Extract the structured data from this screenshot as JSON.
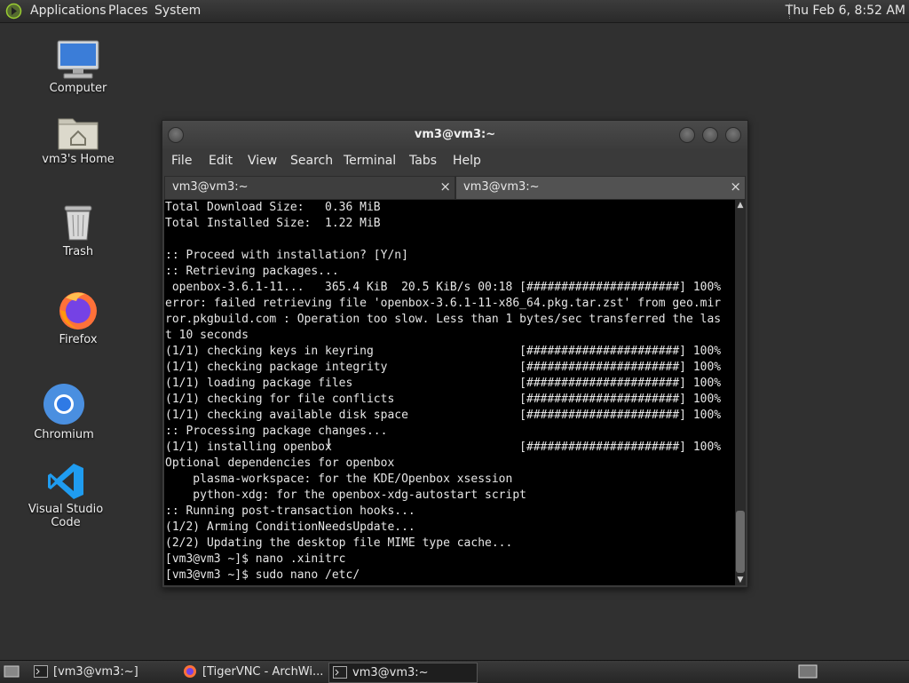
{
  "top_panel": {
    "menus": [
      "Applications",
      "Places",
      "System"
    ],
    "clock": "Thu Feb  6,  8:52 AM"
  },
  "desktop_icons": [
    {
      "label": "Computer",
      "icon": "computer-icon"
    },
    {
      "label": "vm3's Home",
      "icon": "home-folder-icon"
    },
    {
      "label": "Trash",
      "icon": "trash-icon"
    },
    {
      "label": "Firefox",
      "icon": "firefox-icon"
    },
    {
      "label": "Chromium",
      "icon": "chromium-icon"
    },
    {
      "label": "Visual Studio Code",
      "icon": "vscode-icon"
    }
  ],
  "terminal": {
    "title": "vm3@vm3:~",
    "menu": [
      "File",
      "Edit",
      "View",
      "Search",
      "Terminal",
      "Tabs",
      "Help"
    ],
    "tabs": [
      {
        "label": "vm3@vm3:~",
        "close": "×"
      },
      {
        "label": "vm3@vm3:~",
        "close": "×"
      }
    ],
    "lines": [
      "Total Download Size:   0.36 MiB",
      "Total Installed Size:  1.22 MiB",
      "",
      ":: Proceed with installation? [Y/n]",
      ":: Retrieving packages...",
      " openbox-3.6.1-11...   365.4 KiB  20.5 KiB/s 00:18 [######################] 100%",
      "error: failed retrieving file 'openbox-3.6.1-11-x86_64.pkg.tar.zst' from geo.mir",
      "ror.pkgbuild.com : Operation too slow. Less than 1 bytes/sec transferred the las",
      "t 10 seconds",
      "(1/1) checking keys in keyring                     [######################] 100%",
      "(1/1) checking package integrity                   [######################] 100%",
      "(1/1) loading package files                        [######################] 100%",
      "(1/1) checking for file conflicts                  [######################] 100%",
      "(1/1) checking available disk space                [######################] 100%",
      ":: Processing package changes...",
      "(1/1) installing openbox                           [######################] 100%",
      "Optional dependencies for openbox",
      "    plasma-workspace: for the KDE/Openbox xsession",
      "    python-xdg: for the openbox-xdg-autostart script",
      ":: Running post-transaction hooks...",
      "(1/2) Arming ConditionNeedsUpdate...",
      "(2/2) Updating the desktop file MIME type cache...",
      "[vm3@vm3 ~]$ nano .xinitrc",
      "[vm3@vm3 ~]$ sudo nano /etc/"
    ]
  },
  "taskbar": {
    "items": [
      {
        "label": "[vm3@vm3:~]",
        "icon": "terminal-icon",
        "active": false
      },
      {
        "label": "[TigerVNC - ArchWi...",
        "icon": "firefox-icon",
        "active": false
      },
      {
        "label": "vm3@vm3:~",
        "icon": "terminal-icon",
        "active": true
      }
    ]
  }
}
